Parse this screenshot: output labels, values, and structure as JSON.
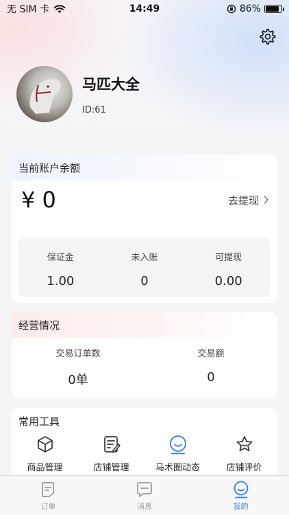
{
  "status_bar": {
    "carrier": "无 SIM 卡",
    "time": "14:49",
    "battery": "86%",
    "battery_level": 0.86
  },
  "profile": {
    "name": "马匹大全",
    "id": "ID:61"
  },
  "balance": {
    "title": "当前账户余额",
    "amount": "¥ 0",
    "withdraw_label": "去提现",
    "stats": [
      {
        "label": "保证金",
        "value": "1.00"
      },
      {
        "label": "未入账",
        "value": "0"
      },
      {
        "label": "可提现",
        "value": "0.00"
      }
    ]
  },
  "business": {
    "title": "经营情况",
    "stats": [
      {
        "label": "交易订单数",
        "value": "0单"
      },
      {
        "label": "交易额",
        "value": "0"
      }
    ]
  },
  "tools": {
    "title": "常用工具",
    "items": [
      {
        "label": "商品管理",
        "icon": "cube-icon"
      },
      {
        "label": "店铺管理",
        "icon": "edit-list-icon"
      },
      {
        "label": "马术圈动态",
        "icon": "smile-circle-icon"
      },
      {
        "label": "店铺评价",
        "icon": "star-icon"
      }
    ]
  },
  "tab_bar": {
    "items": [
      {
        "label": "订单",
        "icon": "order-icon",
        "active": false
      },
      {
        "label": "消息",
        "icon": "message-icon",
        "active": false
      },
      {
        "label": "我的",
        "icon": "profile-smile-icon",
        "active": true
      }
    ]
  },
  "colors": {
    "accent": "#2f7cf6",
    "inactive": "#999999"
  }
}
